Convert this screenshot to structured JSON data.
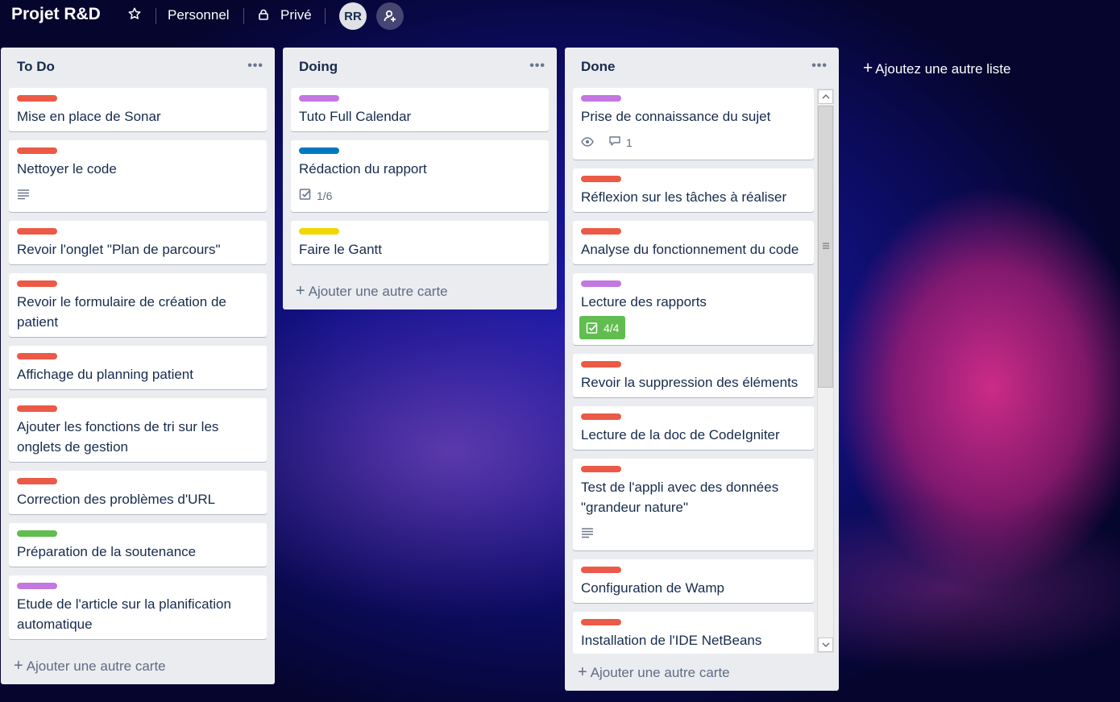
{
  "header": {
    "board_title": "Projet R&D",
    "team": "Personnel",
    "visibility": "Privé",
    "avatar_initials": "RR",
    "icons": [
      "star-icon",
      "lock-icon",
      "add-member-icon"
    ]
  },
  "colors": {
    "label_red": "#eb5a46",
    "label_purple": "#c377e0",
    "label_blue": "#0079bf",
    "label_yellow": "#f2d600",
    "label_green": "#61bd4f",
    "list_bg": "#ebecf0"
  },
  "lists": [
    {
      "title": "To Do",
      "menu": "•••",
      "cards": [
        {
          "title": "Mise en place de Sonar",
          "label": "red"
        },
        {
          "title": "Nettoyer le code",
          "label": "red",
          "has_description": true
        },
        {
          "title": "Revoir l'onglet \"Plan de parcours\"",
          "label": "red"
        },
        {
          "title": "Revoir le formulaire de création de patient",
          "label": "red"
        },
        {
          "title": "Affichage du planning patient",
          "label": "red"
        },
        {
          "title": "Ajouter les fonctions de tri sur les onglets de gestion",
          "label": "red"
        },
        {
          "title": "Correction des problèmes d'URL",
          "label": "red"
        },
        {
          "title": "Préparation de la soutenance",
          "label": "green"
        },
        {
          "title": "Etude de l'article sur la planification automatique",
          "label": "purple"
        }
      ],
      "add_card": "Ajouter une autre carte"
    },
    {
      "title": "Doing",
      "menu": "•••",
      "cards": [
        {
          "title": "Tuto Full Calendar",
          "label": "purple"
        },
        {
          "title": "Rédaction du rapport",
          "label": "blue",
          "checklist": "1/6"
        },
        {
          "title": "Faire le Gantt",
          "label": "yellow"
        }
      ],
      "add_card": "Ajouter une autre carte"
    },
    {
      "title": "Done",
      "menu": "•••",
      "cards": [
        {
          "title": "Prise de connaissance du sujet",
          "label": "purple",
          "watching": true,
          "comments": "1"
        },
        {
          "title": "Réflexion sur les tâches à réaliser",
          "label": "red"
        },
        {
          "title": "Analyse du fonctionnement du code",
          "label": "red"
        },
        {
          "title": "Lecture des rapports",
          "label": "purple",
          "checklist_complete": "4/4"
        },
        {
          "title": "Revoir la suppression des éléments",
          "label": "red"
        },
        {
          "title": "Lecture de la doc de CodeIgniter",
          "label": "red"
        },
        {
          "title": "Test de l'appli avec des données \"grandeur nature\"",
          "label": "red",
          "has_description": true
        },
        {
          "title": "Configuration de Wamp",
          "label": "red"
        },
        {
          "title": "Installation de l'IDE NetBeans",
          "label": "red"
        }
      ],
      "add_card": "Ajouter une autre carte"
    }
  ],
  "add_list": "Ajoutez une autre liste"
}
